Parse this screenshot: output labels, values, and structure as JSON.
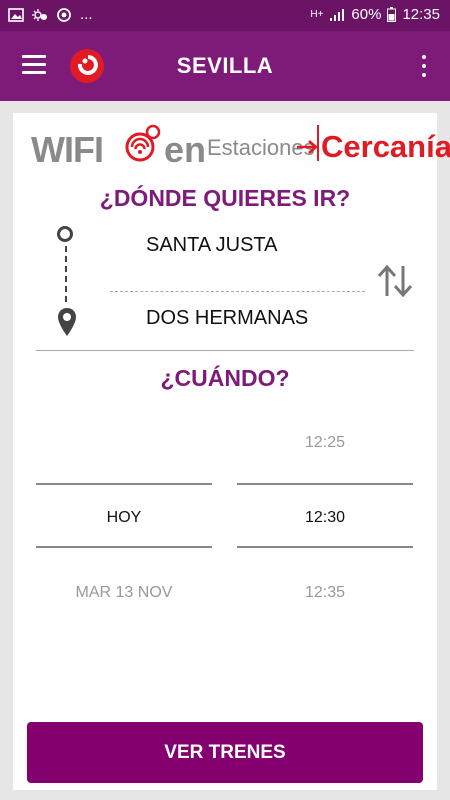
{
  "status_bar": {
    "battery": "60%",
    "time": "12:35",
    "network": "H+",
    "dots": "..."
  },
  "app_bar": {
    "title": "SEVILLA"
  },
  "banner": {
    "wifi": "WIFI",
    "en": "en",
    "estaciones": "Estaciones",
    "cercanias": "Cercanías"
  },
  "route": {
    "heading": "¿DÓNDE QUIERES IR?",
    "origin": "SANTA JUSTA",
    "destination": "DOS HERMANAS"
  },
  "when": {
    "heading": "¿CUÁNDO?",
    "date_options": [
      "",
      "HOY",
      "MAR 13 NOV"
    ],
    "time_options": [
      "12:25",
      "12:30",
      "12:35"
    ],
    "selected_date": "HOY",
    "selected_time": "12:30"
  },
  "action": {
    "button_label": "VER TRENES"
  },
  "colors": {
    "primary": "#7e1a78",
    "status_bar": "#6b1466",
    "button": "#83006e",
    "accent_red": "#e01b24"
  }
}
